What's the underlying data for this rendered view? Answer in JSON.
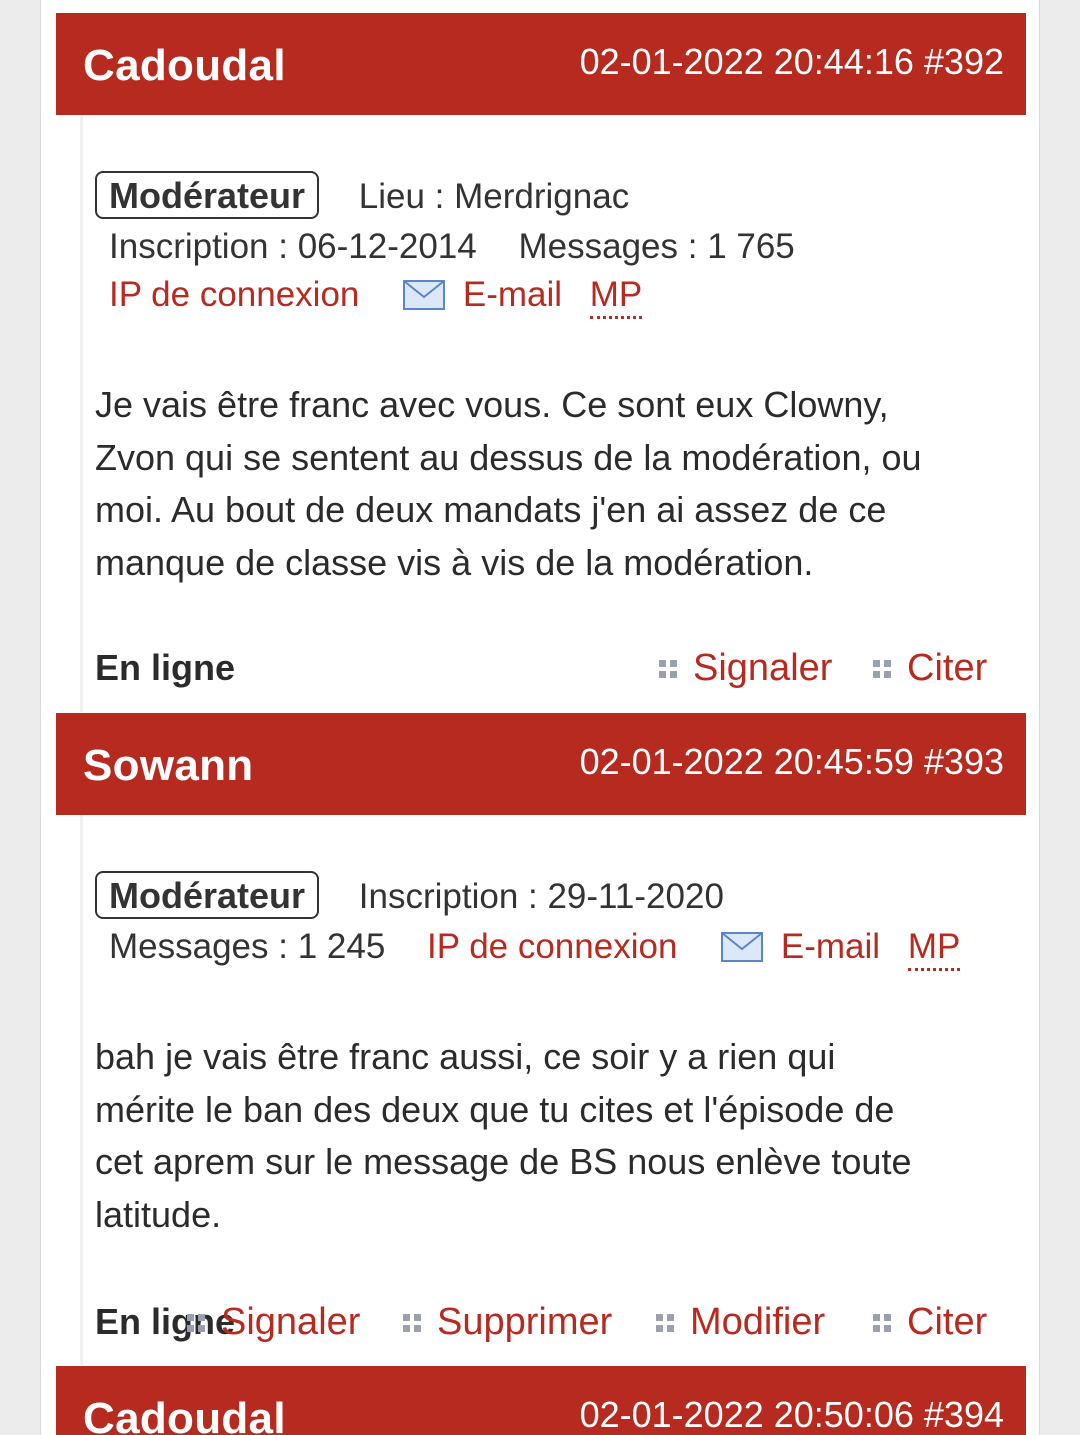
{
  "posts": [
    {
      "author": "Cadoudal",
      "datetime": "02-01-2022 20:44:16",
      "number": "#392",
      "role": "Modérateur",
      "lieu_label": "Lieu :",
      "lieu": "Merdrignac",
      "inscription_label": "Inscription :",
      "inscription": "06-12-2014",
      "messages_label": "Messages :",
      "messages": "1 765",
      "ip_label": "IP de connexion",
      "email_label": "E-mail",
      "mp_label": "MP",
      "lines": [
        "Je vais être franc avec vous. Ce sont eux Clowny,",
        "Zvon qui se sentent au dessus de la modération, ou",
        "moi. Au bout de deux mandats j'en ai assez de ce",
        "manque de classe vis à vis de la modération."
      ],
      "status": "En ligne",
      "actions": [
        "Signaler",
        "Citer"
      ]
    },
    {
      "author": "Sowann",
      "datetime": "02-01-2022 20:45:59",
      "number": "#393",
      "role": "Modérateur",
      "inscription_label": "Inscription :",
      "inscription": "29-11-2020",
      "messages_label": "Messages :",
      "messages": "1 245",
      "ip_label": "IP de connexion",
      "email_label": "E-mail",
      "mp_label": "MP",
      "lines": [
        "bah je vais être franc aussi, ce soir y a rien qui",
        "mérite le ban des deux que tu cites et l'épisode de",
        "cet aprem sur le message de BS nous enlève toute",
        "latitude."
      ],
      "status": "En ligne",
      "actions": [
        "Signaler",
        "Supprimer",
        "Modifier",
        "Citer"
      ]
    },
    {
      "author": "Cadoudal",
      "datetime": "02-01-2022 20:50:06",
      "number": "#394"
    }
  ],
  "colors": {
    "header_red": "#b72a1f",
    "link_red": "#b72a1f",
    "text": "#2b2b2b"
  },
  "icons": [
    "mail-icon",
    "grip-dots-icon"
  ]
}
